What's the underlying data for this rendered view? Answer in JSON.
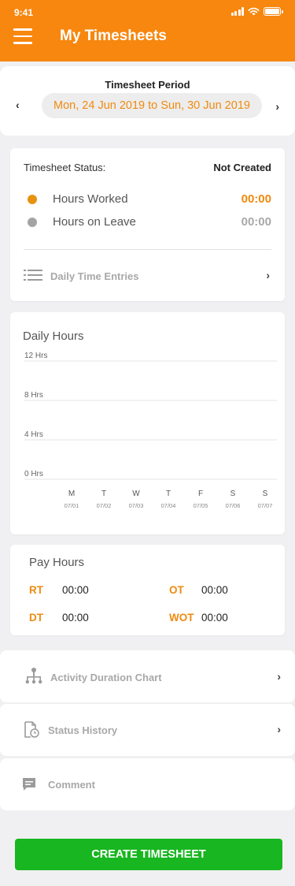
{
  "status_bar": {
    "time": "9:41"
  },
  "app_bar": {
    "title": "My Timesheets"
  },
  "period": {
    "label": "Timesheet Period",
    "range": "Mon, 24 Jun 2019 to Sun, 30 Jun 2019",
    "prev_icon": "chevron-left-icon",
    "next_icon": "chevron-right-icon"
  },
  "status_card": {
    "status_label": "Timesheet Status:",
    "status_value": "Not Created",
    "rows": [
      {
        "label": "Hours Worked",
        "value": "00:00",
        "color": "#f08a0f"
      },
      {
        "label": "Hours on Leave",
        "value": "00:00",
        "color": "#a8a8a8"
      }
    ],
    "daily_entries_label": "Daily Time Entries"
  },
  "daily_hours": {
    "title": "Daily Hours"
  },
  "chart_data": {
    "type": "bar",
    "title": "Daily Hours",
    "y_tick_labels": [
      "12 Hrs",
      "8 Hrs",
      "4 Hrs",
      "0 Hrs"
    ],
    "y_ticks": [
      12,
      8,
      4,
      0
    ],
    "ylim": [
      0,
      12
    ],
    "categories": [
      "M",
      "T",
      "W",
      "T",
      "F",
      "S",
      "S"
    ],
    "dates": [
      "07/01",
      "07/02",
      "07/03",
      "07/04",
      "07/05",
      "07/06",
      "07/07"
    ],
    "values": [
      0,
      0,
      0,
      0,
      0,
      0,
      0
    ],
    "grid": true
  },
  "pay_hours": {
    "title": "Pay Hours",
    "items": [
      {
        "code": "RT",
        "value": "00:00"
      },
      {
        "code": "OT",
        "value": "00:00"
      },
      {
        "code": "DT",
        "value": "00:00"
      },
      {
        "code": "WOT",
        "value": "00:00"
      }
    ]
  },
  "nav": {
    "activity_chart": "Activity Duration Chart",
    "status_history": "Status History",
    "comment": "Comment"
  },
  "create_button": "CREATE TIMESHEET",
  "colors": {
    "brand": "#f7870f",
    "accent_text": "#f08a0f",
    "primary_button": "#18b620"
  }
}
